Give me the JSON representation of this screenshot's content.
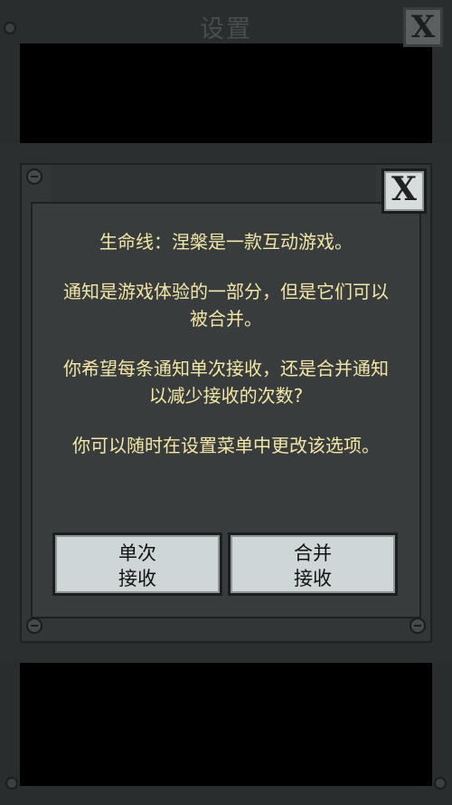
{
  "background": {
    "title": "设置",
    "close_label": "X"
  },
  "dialog": {
    "close_label": "X",
    "paragraphs": [
      "生命线：涅槃是一款互动游戏。",
      "通知是游戏体验的一部分，但是它们可以被合并。",
      "你希望每条通知单次接收，还是合并通知以减少接收的次数?",
      "你可以随时在设置菜单中更改该选项。"
    ],
    "buttons": {
      "single": {
        "line1": "单次",
        "line2": "接收"
      },
      "merge": {
        "line1": "合并",
        "line2": "接收"
      }
    }
  },
  "colors": {
    "text": "#f3e6a6",
    "button_bg": "#cfd6d7",
    "panel_bg": "#383c3d"
  }
}
